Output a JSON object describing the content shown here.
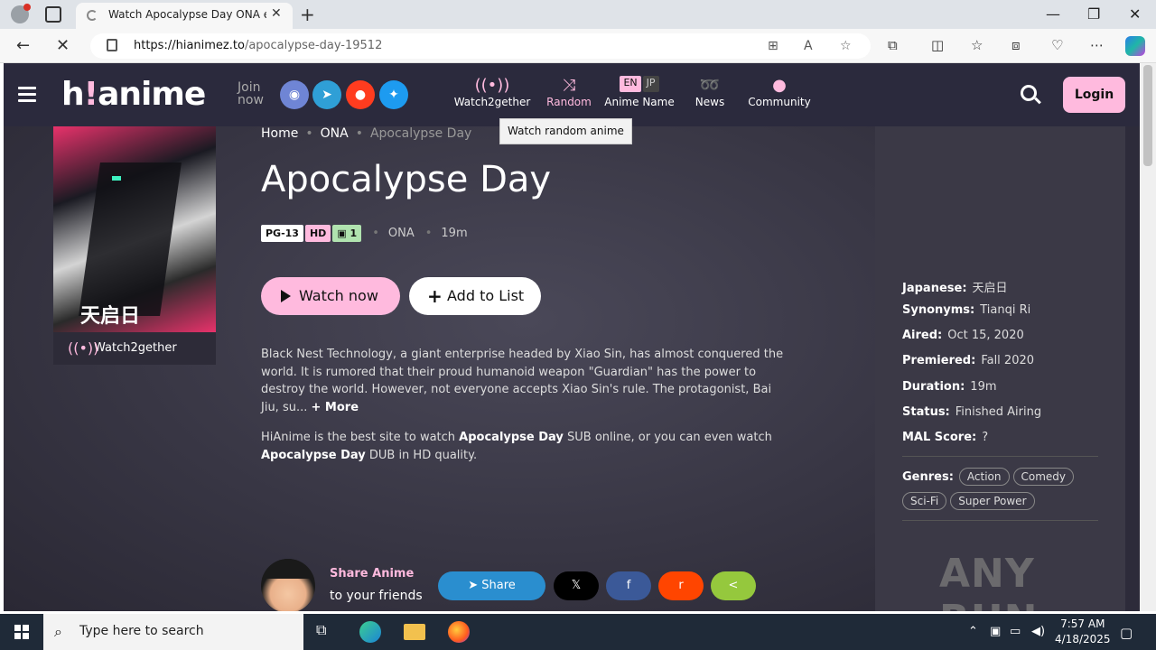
{
  "browser": {
    "tab_title": "Watch Apocalypse Day ONA episodes",
    "url_host": "https://hianimez.to",
    "url_path": "/apocalypse-day-19512",
    "new_tab": "+",
    "close_tab": "✕"
  },
  "site": {
    "logo_a": "h",
    "logo_bang": "!",
    "logo_b": "anime",
    "join_line1": "Join",
    "join_line2": "now",
    "nav": [
      {
        "label": "Watch2gether",
        "icon": "broadcast-icon"
      },
      {
        "label": "Random",
        "icon": "shuffle-icon"
      },
      {
        "label": "Anime Name",
        "icon": "language-toggle",
        "en": "EN",
        "jp": "JP"
      },
      {
        "label": "News",
        "icon": "rss-icon"
      },
      {
        "label": "Community",
        "icon": "chat-icon"
      }
    ],
    "login": "Login",
    "tooltip": "Watch random anime"
  },
  "anime": {
    "breadcrumb": [
      "Home",
      "ONA",
      "Apocalypse Day"
    ],
    "title": "Apocalypse Day",
    "rating": "PG-13",
    "quality": "HD",
    "cc_count": "1",
    "type": "ONA",
    "duration": "19m",
    "watch_now": "Watch now",
    "add_to_list": "Add to List",
    "poster_text": "天启日",
    "watch2gether": "Watch2gether",
    "description": "Black Nest Technology, a giant enterprise headed by Xiao Sin, has almost conquered the world. It is rumored that their proud humanoid weapon \"Guardian\" has the power to destroy the world. However, not everyone accepts Xiao Sin's rule. The protagonist, Bai Jiu, su...",
    "more": "+ More",
    "seo_1": "HiAnime is the best site to watch ",
    "seo_title_1": "Apocalypse Day",
    "seo_2": " SUB online, or you can even watch ",
    "seo_title_2": "Apocalypse Day",
    "seo_3": " DUB in HD quality.",
    "share_title": "Share Anime",
    "share_sub": "to your friends",
    "share_buttons": [
      "Share",
      "𝕏",
      "f",
      "r",
      "<"
    ]
  },
  "info": {
    "japanese_label": "Japanese:",
    "japanese": "天启日",
    "synonyms_label": "Synonyms:",
    "synonyms": "Tianqi Ri",
    "aired_label": "Aired:",
    "aired": "Oct 15, 2020",
    "premiered_label": "Premiered:",
    "premiered": "Fall 2020",
    "duration_label": "Duration:",
    "duration": "19m",
    "status_label": "Status:",
    "status": "Finished Airing",
    "mal_label": "MAL Score:",
    "mal": "?",
    "genres_label": "Genres:",
    "genres": [
      "Action",
      "Comedy",
      "Sci-Fi",
      "Super Power"
    ]
  },
  "watermark": "ANY RUN",
  "taskbar": {
    "search_placeholder": "Type here to search",
    "time": "7:57 AM",
    "date": "4/18/2025"
  },
  "colors": {
    "accent": "#ffbade",
    "bg": "#2d2b3a"
  }
}
